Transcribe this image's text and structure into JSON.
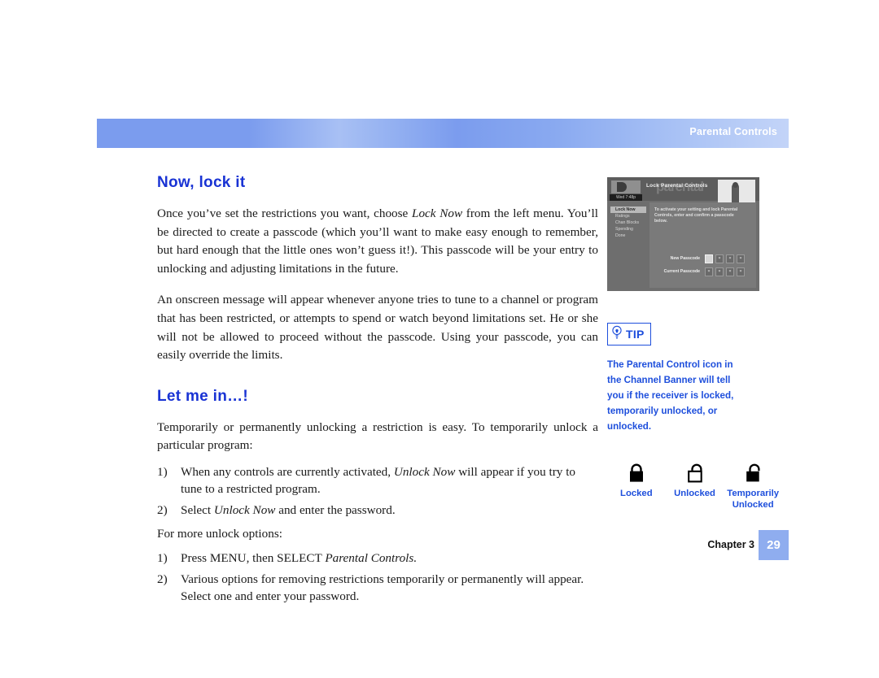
{
  "header": {
    "title": "Parental Controls",
    "banner_color": "#7b9cee"
  },
  "accent_color": "#1e4fdc",
  "main": {
    "heading_1": "Now, lock it",
    "paragraph_1_a": "Once you’ve set the restrictions you want, choose ",
    "paragraph_1_em": "Lock Now",
    "paragraph_1_b": " from the left menu. You’ll be directed to create a passcode (which you’ll want to make easy enough to remember, but hard enough that the little ones won’t guess it!). This passcode will be your entry to unlocking and adjusting limitations in the future.",
    "paragraph_2": "An onscreen message will appear whenever anyone tries to tune to a channel or program that has been restricted, or attempts to spend or watch beyond limitations set. He or she will not be allowed to proceed without the passcode. Using your passcode, you can easily override the limits.",
    "heading_2": "Let me in…!",
    "paragraph_3": "Temporarily or permanently unlocking a restriction is easy. To temporarily unlock a particular program:",
    "list_1": [
      {
        "num": "1)",
        "text_a": "When any controls are currently activated, ",
        "em": "Unlock Now",
        "text_b": " will appear if you try to tune to a restricted program."
      },
      {
        "num": "2)",
        "text_a": "Select ",
        "em": "Unlock Now",
        "text_b": " and enter the password."
      }
    ],
    "paragraph_4": "For more unlock options:",
    "list_2": [
      {
        "num": "1)",
        "text_a": "Press MENU, then SELECT ",
        "em": "Parental Controls.",
        "text_b": ""
      },
      {
        "num": "2)",
        "text_a": "Various options for removing restrictions temporarily or permanently will appear. Select one and enter your password.",
        "em": "",
        "text_b": ""
      }
    ]
  },
  "screenshot": {
    "clock": "Wed 7:48p",
    "title": "Lock Parental Controls",
    "watermark": "parental",
    "menu_items": [
      "Lock Now",
      "Ratings",
      "Chan Blocks",
      "Spending",
      "Done"
    ],
    "instruction": "To activate your setting and lock Parental Controls, enter and confirm a passcode below.",
    "rows": [
      {
        "label": "New Passcode",
        "digits": [
          "",
          "*",
          "*",
          "*"
        ]
      },
      {
        "label": "Current Passcode",
        "digits": [
          "*",
          "*",
          "*",
          "*"
        ]
      }
    ]
  },
  "tip": {
    "label": "TIP",
    "icon": "lightbulb-icon",
    "body": "The Parental Control icon in the Channel Banner will tell you if the receiver is locked, temporarily unlocked, or unlocked."
  },
  "lock_legend": [
    {
      "icon": "padlock-closed-icon",
      "label": "Locked"
    },
    {
      "icon": "padlock-open-outline-icon",
      "label": "Unlocked"
    },
    {
      "icon": "padlock-open-filled-icon",
      "label": "Temporarily Unlocked"
    }
  ],
  "footer": {
    "chapter": "Chapter 3",
    "page": "29"
  }
}
